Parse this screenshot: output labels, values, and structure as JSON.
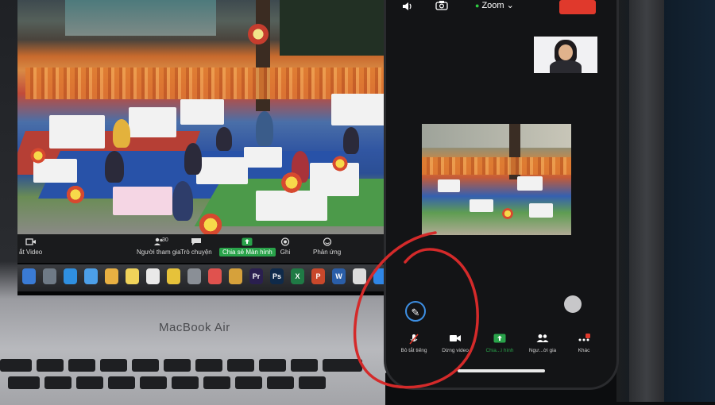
{
  "zoom_toolbar": {
    "items": [
      {
        "label": "ắt Video"
      },
      {
        "label": "Người tham gia",
        "count": "30"
      },
      {
        "label": "Trò chuyện"
      },
      {
        "label": "Chia sẻ Màn hình"
      },
      {
        "label": "Ghi"
      },
      {
        "label": "Phản ứng"
      }
    ]
  },
  "dock": {
    "apps": [
      {
        "icon": "finder-icon",
        "color": "#3a7bd5",
        "text": ""
      },
      {
        "icon": "launchpad-icon",
        "color": "#6f7a86",
        "text": ""
      },
      {
        "icon": "safari-icon",
        "color": "#2f8fe0",
        "text": ""
      },
      {
        "icon": "mail-icon",
        "color": "#4c9fe8",
        "text": ""
      },
      {
        "icon": "photos-icon",
        "color": "#e8b042",
        "text": ""
      },
      {
        "icon": "notes-icon",
        "color": "#f0d35a",
        "text": ""
      },
      {
        "icon": "reminders-icon",
        "color": "#e9e9e9",
        "text": ""
      },
      {
        "icon": "chrome-icon",
        "color": "#e6c23a",
        "text": ""
      },
      {
        "icon": "system-icon",
        "color": "#8a8f96",
        "text": ""
      },
      {
        "icon": "music-icon",
        "color": "#e0524e",
        "text": ""
      },
      {
        "icon": "app-icon",
        "color": "#d6a13b",
        "text": ""
      },
      {
        "icon": "premiere-icon",
        "color": "#2a1f4f",
        "text": "Pr"
      },
      {
        "icon": "photoshop-icon",
        "color": "#0f2a4a",
        "text": "Ps"
      },
      {
        "icon": "excel-icon",
        "color": "#1f7a45",
        "text": "X"
      },
      {
        "icon": "powerpoint-icon",
        "color": "#c9482b",
        "text": "P"
      },
      {
        "icon": "word-icon",
        "color": "#2a5ea8",
        "text": "W"
      },
      {
        "icon": "preview-icon",
        "color": "#dcdcdc",
        "text": ""
      },
      {
        "icon": "appstore-icon",
        "color": "#2f86e6",
        "text": ""
      }
    ]
  },
  "laptop": {
    "brand_label": "MacBook Air"
  },
  "phone": {
    "app_title": "Zoom",
    "toolbar": [
      {
        "icon": "mic-off-icon",
        "label": "Bỏ tắt tiếng"
      },
      {
        "icon": "video-icon",
        "label": "Dừng video"
      },
      {
        "icon": "share-screen-icon",
        "label": "Chia...ì hình"
      },
      {
        "icon": "participants-icon",
        "label": "Ngư...ời gia"
      },
      {
        "icon": "more-icon",
        "label": "Khác"
      }
    ],
    "colors": {
      "leave": "#e0392c",
      "share_active": "#29a34a",
      "annotation_ring": "#d42a2a"
    }
  }
}
